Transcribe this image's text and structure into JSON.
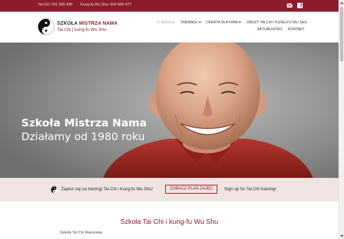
{
  "topbar": {
    "phone_taichi": "Tai Chi: 501 505 430",
    "phone_kungfu": "Kung-fu Wu Shu: 602 665 477",
    "icons": [
      "mail-icon",
      "facebook-icon"
    ],
    "facebook_glyph": "f"
  },
  "brand": {
    "title_part1": "SZKOŁA",
    "title_part2": "MISTRZA NAMA",
    "subtitle": "Tai Chi | kung-fu Wu Shu"
  },
  "nav": {
    "row1": [
      {
        "label": "O szkole",
        "dropdown": false,
        "active": true
      },
      {
        "label": "Treningi",
        "dropdown": true,
        "active": false
      },
      {
        "label": "Oferta dla firm",
        "dropdown": true,
        "active": false
      },
      {
        "label": "Obozy Tai Chi i Kung-fu Wu Shu",
        "dropdown": false,
        "active": false
      }
    ],
    "row2": [
      {
        "label": "Aktualności"
      },
      {
        "label": "Kontakt"
      }
    ]
  },
  "hero": {
    "title": "Szkoła Mistrza Nama",
    "subtitle": "Działamy od 1980 roku"
  },
  "cta": {
    "text_pl": "Zapisz się na treningi Tai Chi i Kung-fu Wu Shu!",
    "button_label": "ZOBACZ PLAN ZAJĘĆ",
    "text_en": "Sign up for Tai Chi training!"
  },
  "section": {
    "title": "Szkoła Tai Chi i kung-fu Wu Shu",
    "text": "Szkoła Tai Chi Warszawa"
  },
  "colors": {
    "brand": "#8c1c2c",
    "cta_background": "#efe4e1",
    "hero_background": "#8a8a8a"
  }
}
